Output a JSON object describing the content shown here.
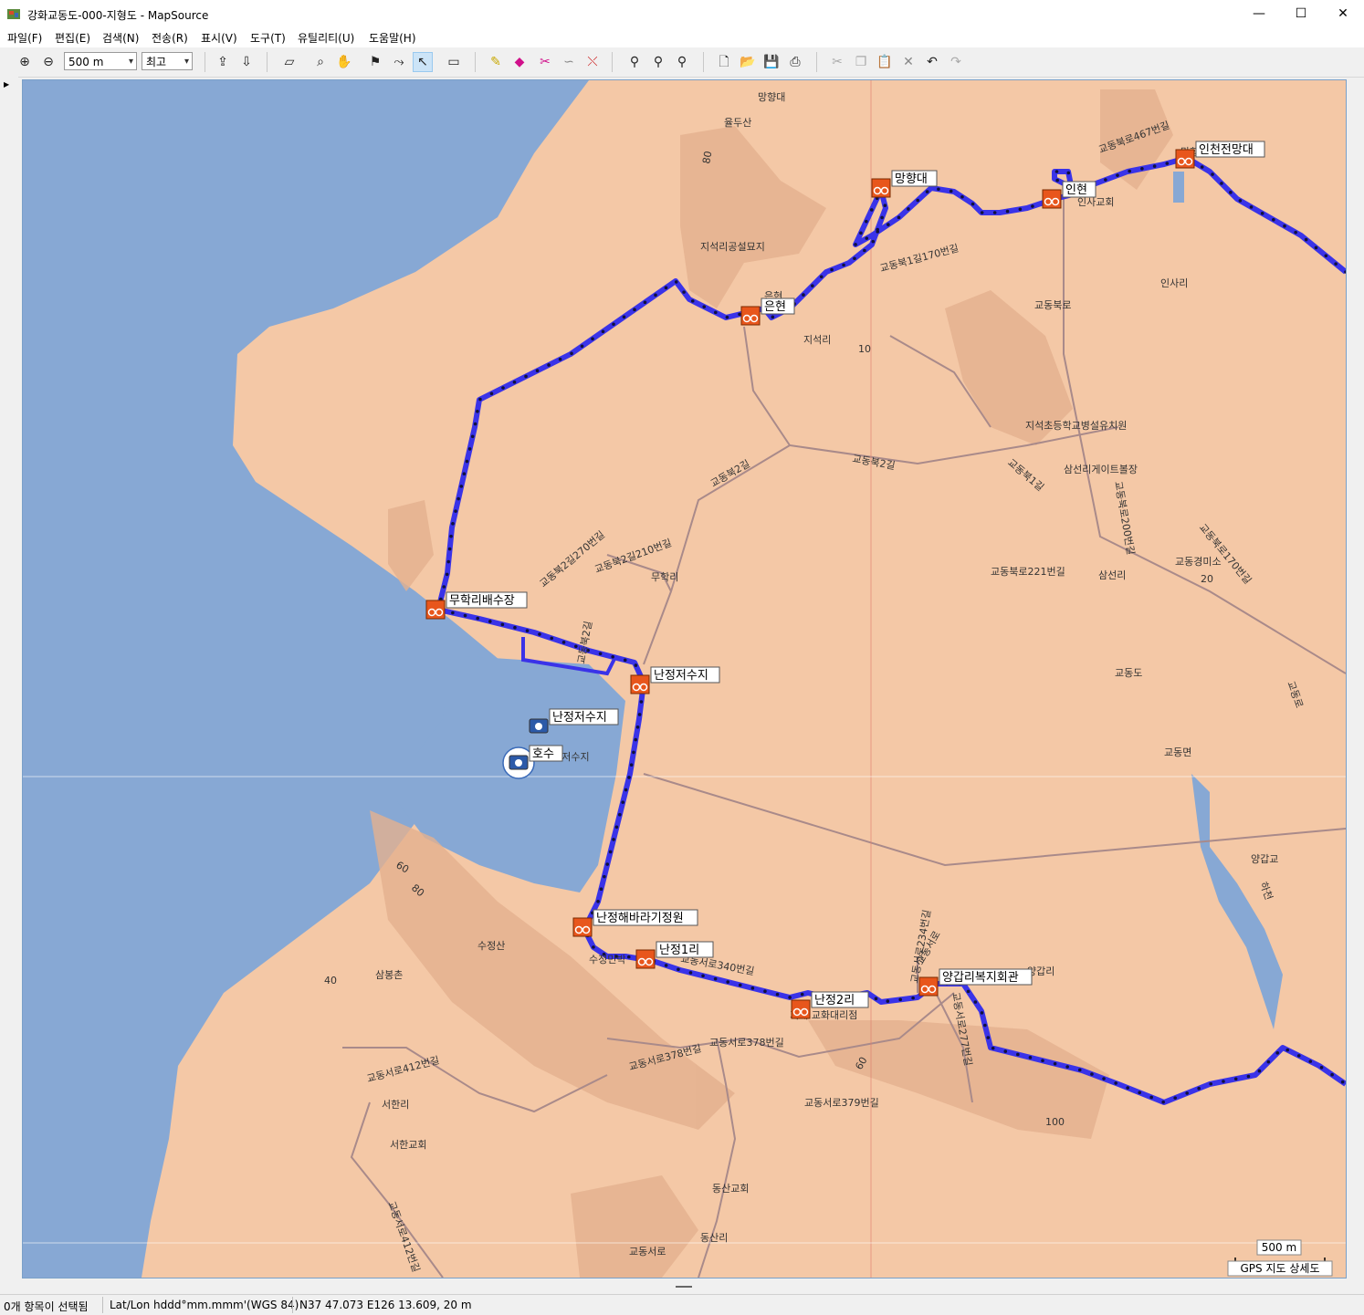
{
  "window": {
    "title": "강화교동도-000-지형도 - MapSource",
    "minimize_label": "—",
    "maximize_label": "☐",
    "close_label": "✕"
  },
  "menu": {
    "items": [
      "파일(F)",
      "편집(E)",
      "검색(N)",
      "전송(R)",
      "표시(V)",
      "도구(T)",
      "유틸리티(U)",
      "도움말(H)"
    ]
  },
  "toolbar": {
    "zoom_value": "500 m",
    "detail_value": "최고"
  },
  "map": {
    "route_color": "#3a33e8",
    "land_color": "#f4c8a6",
    "water_color": "#87a8d4",
    "waypoints": [
      {
        "label": "인천전망대",
        "icon": "bike-icon"
      },
      {
        "label": "인현",
        "icon": "bike-icon"
      },
      {
        "label": "망향대",
        "icon": "bike-icon"
      },
      {
        "label": "은현",
        "icon": "bike-icon"
      },
      {
        "label": "무학리배수장",
        "icon": "bike-icon"
      },
      {
        "label": "난정저수지",
        "icon": "bike-icon"
      },
      {
        "label": "난정저수지",
        "icon": "camera-icon"
      },
      {
        "label": "호수",
        "icon": "camera-icon"
      },
      {
        "label": "난정해바라기정원",
        "icon": "bike-icon"
      },
      {
        "label": "난정1리",
        "icon": "bike-icon"
      },
      {
        "label": "난정2리",
        "icon": "bike-icon"
      },
      {
        "label": "양갑리복지회관",
        "icon": "bike-icon"
      }
    ],
    "place_labels": [
      "망향대",
      "율두산",
      "80",
      "지석리공설묘지",
      "은현",
      "지석리",
      "10",
      "교동북1길170번길",
      "교동북로467번길",
      "인사교회",
      "망향로당",
      "인사리",
      "교동북로",
      "지석초등학교병설유치원",
      "교동북2길",
      "교동북2길",
      "교동북1길",
      "삼선리게이트볼장",
      "교동북로200번길",
      "교동북로170번길",
      "교동경미소",
      "20",
      "교동북로221번길",
      "삼선리",
      "교동북2길270번길",
      "교동북2길210번길",
      "무학리",
      "교동북2길",
      "교동도",
      "교동로",
      "교동면",
      "양갑교",
      "하천",
      "60",
      "80",
      "수정산",
      "삼봉촌",
      "40",
      "수정민박",
      "교동서로340번길",
      "교동서로234번길",
      "교동서로277번길",
      "양갑리",
      "교동서로",
      "교동서로378번길",
      "교동서로378번길",
      "기계 교화대리점",
      "60",
      "교동서로379번길",
      "100",
      "교동서로412번길",
      "서한리",
      "서한교회",
      "교동서로412번길",
      "동산교회",
      "동산리",
      "교동서로",
      "난정저수지"
    ],
    "scale_label": "500 m",
    "map_product": "GPS 지도 상세도"
  },
  "status": {
    "selection": "0개 항목이 선택됨",
    "format": "Lat/Lon hddd°mm.mmm'(WGS 84)",
    "position": "N37 47.073 E126 13.609, 20 m"
  }
}
